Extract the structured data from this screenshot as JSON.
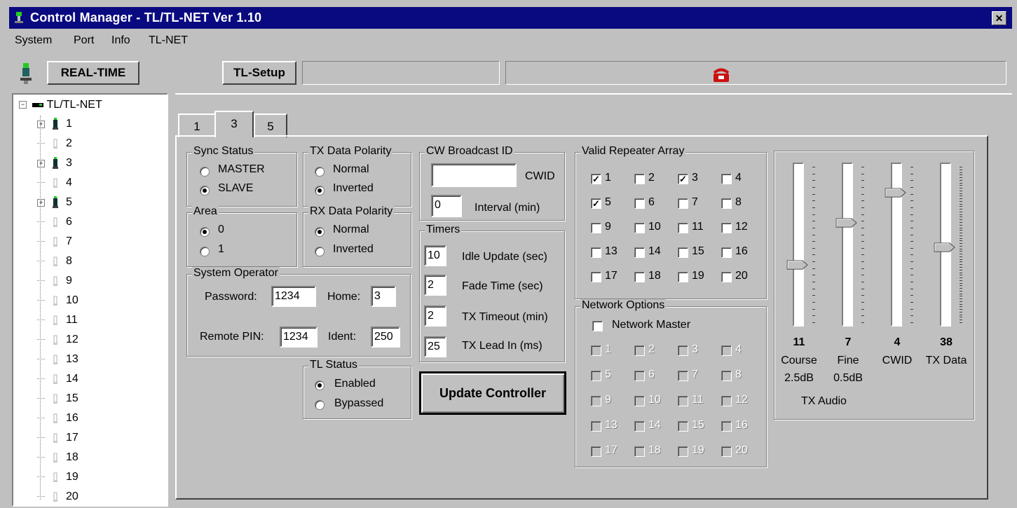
{
  "window": {
    "title": "Control Manager - TL/TL-NET Ver 1.10",
    "close_glyph": "✕"
  },
  "menu": [
    "System",
    "Port",
    "Info",
    "TL-NET"
  ],
  "toolbar": {
    "realtime_label": "REAL-TIME",
    "setup_label": "TL-Setup",
    "status_text": ""
  },
  "tree": {
    "root": "TL/TL-NET",
    "nodes": [
      "1",
      "2",
      "3",
      "4",
      "5",
      "6",
      "7",
      "8",
      "9",
      "10",
      "11",
      "12",
      "13",
      "14",
      "15",
      "16",
      "17",
      "18",
      "19",
      "20"
    ],
    "expandable": [
      "1",
      "3",
      "5"
    ]
  },
  "tabs": [
    "1",
    "3",
    "5"
  ],
  "active_tab": "3",
  "sync_status": {
    "label": "Sync Status",
    "options": [
      "MASTER",
      "SLAVE"
    ],
    "selected": "SLAVE"
  },
  "area": {
    "label": "Area",
    "options": [
      "0",
      "1"
    ],
    "selected": "0"
  },
  "tx_polarity": {
    "label": "TX Data Polarity",
    "options": [
      "Normal",
      "Inverted"
    ],
    "selected": "Inverted"
  },
  "rx_polarity": {
    "label": "RX Data Polarity",
    "options": [
      "Normal",
      "Inverted"
    ],
    "selected": "Normal"
  },
  "system_operator": {
    "label": "System Operator",
    "password_label": "Password:",
    "password": "1234",
    "home_label": "Home:",
    "home": "3",
    "pin_label": "Remote PIN:",
    "pin": "1234",
    "ident_label": "Ident:",
    "ident": "250"
  },
  "tl_status": {
    "label": "TL Status",
    "options": [
      "Enabled",
      "Bypassed"
    ],
    "selected": "Enabled"
  },
  "cw": {
    "label": "CW Broadcast ID",
    "cwid_label": "CWID",
    "cwid": "",
    "interval": "0",
    "interval_label": "Interval (min)"
  },
  "timers": {
    "label": "Timers",
    "items": [
      {
        "value": "10",
        "label": "Idle Update (sec)"
      },
      {
        "value": "2",
        "label": "Fade Time (sec)"
      },
      {
        "value": "2",
        "label": "TX Timeout (min)"
      },
      {
        "value": "25",
        "label": "TX Lead In (ms)"
      }
    ]
  },
  "update_button": "Update Controller",
  "valid_repeater": {
    "label": "Valid Repeater Array",
    "items": [
      "1",
      "2",
      "3",
      "4",
      "5",
      "6",
      "7",
      "8",
      "9",
      "10",
      "11",
      "12",
      "13",
      "14",
      "15",
      "16",
      "17",
      "18",
      "19",
      "20"
    ],
    "checked": [
      "1",
      "3",
      "5"
    ]
  },
  "network": {
    "label": "Network Options",
    "master_label": "Network Master",
    "items": [
      "1",
      "2",
      "3",
      "4",
      "5",
      "6",
      "7",
      "8",
      "9",
      "10",
      "11",
      "12",
      "13",
      "14",
      "15",
      "16",
      "17",
      "18",
      "19",
      "20"
    ]
  },
  "tx_audio": {
    "label": "TX Audio",
    "sliders": [
      {
        "value": "11",
        "name": "Course",
        "sub": "2.5dB",
        "level": 0.37
      },
      {
        "value": "7",
        "name": "Fine",
        "sub": "0.5dB",
        "level": 0.63
      },
      {
        "value": "4",
        "name": "CWID",
        "sub": "",
        "level": 0.81
      },
      {
        "value": "38",
        "name": "TX Data",
        "sub": "",
        "level": 0.48
      }
    ]
  },
  "colors": {
    "title_bg": "#0a0a80",
    "face": "#c0c0c0",
    "phone_red": "#cc1010",
    "led_green": "#22cc22"
  }
}
